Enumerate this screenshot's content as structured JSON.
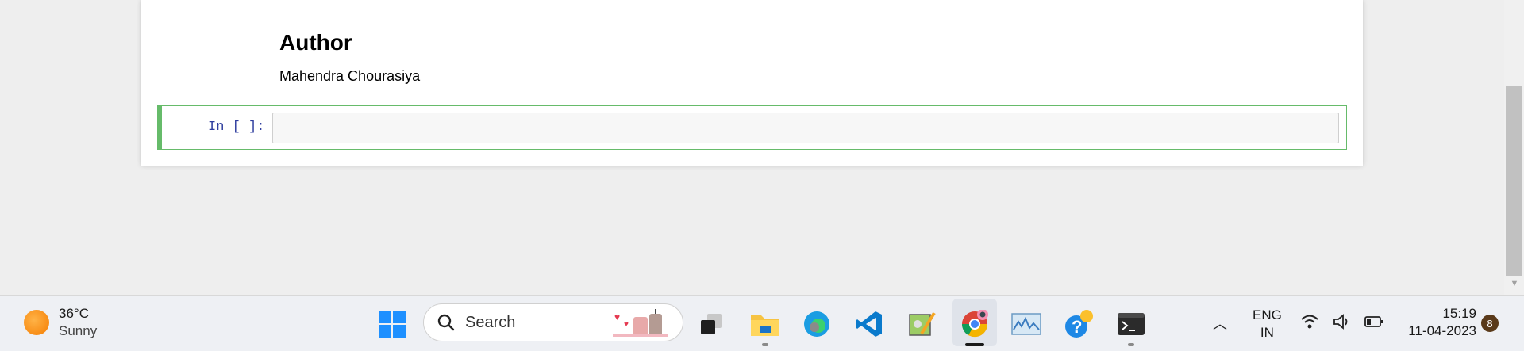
{
  "notebook": {
    "heading": "Author",
    "author_name": "Mahendra Chourasiya",
    "code_prompt": "In [ ]:",
    "code_value": ""
  },
  "taskbar": {
    "weather": {
      "temp": "36°C",
      "condition": "Sunny",
      "icon": "sun-icon"
    },
    "search": {
      "placeholder": "Search"
    },
    "apps": [
      "start-icon",
      "task-view-icon",
      "file-explorer-icon",
      "edge-icon",
      "vscode-icon",
      "paint-icon",
      "chrome-icon",
      "monitor-icon",
      "help-icon",
      "terminal-icon"
    ],
    "language": {
      "line1": "ENG",
      "line2": "IN"
    },
    "clock": {
      "time": "15:19",
      "date": "11-04-2023"
    },
    "notification_count": "8"
  },
  "colors": {
    "cell_selected": "#66bb6a",
    "prompt": "#303f9f",
    "accent": "#0078d4"
  }
}
